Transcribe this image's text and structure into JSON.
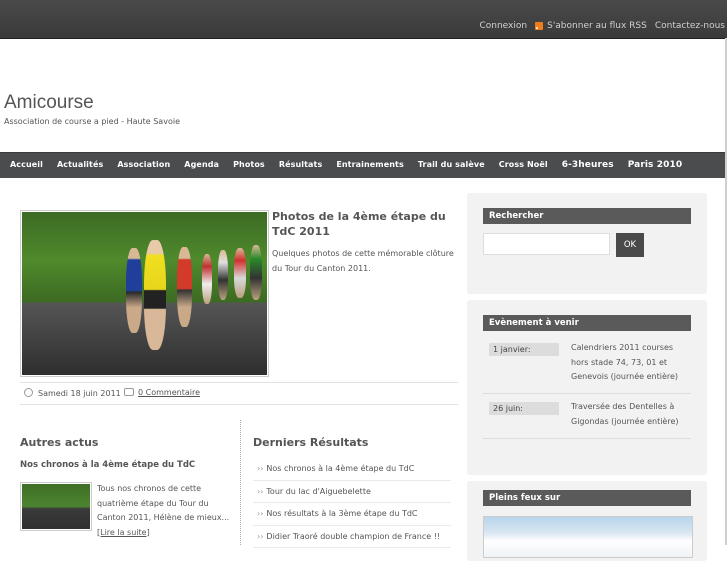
{
  "topbar": {
    "links": [
      "Connexion",
      "S'abonner au flux RSS",
      "Contactez-nous"
    ]
  },
  "site": {
    "title": "Amicourse",
    "description": "Association de course a pied - Haute Savoie"
  },
  "nav": {
    "items": [
      "Accueil",
      "Actualités",
      "Association",
      "Agenda",
      "Photos",
      "Résultats",
      "Entrainements",
      "Trail du salève",
      "Cross Noël",
      "6-3heures",
      "Paris 2010"
    ]
  },
  "featured": {
    "title": "Photos de la 4ème étape du TdC 2011",
    "excerpt": "Quelques photos de cette mémorable clôture du Tour du Canton 2011.",
    "date": "Samedi 18 juin 2011",
    "comments": "0 Commentaire"
  },
  "autres": {
    "heading": "Autres actus",
    "post_title": "Nos chronos à la 4ème étape du TdC",
    "excerpt": "Tous nos chronos de cette quatrième étape du Tour du Canton 2011, Hélène de mieux...",
    "more": "[Lire la suite]"
  },
  "derniers": {
    "heading": "Derniers Résultats",
    "items": [
      "Nos chronos à la 4ème étape du TdC",
      "Tour du lac d'Aiguebelette",
      "Nos résultats à la 3ème étape du TdC",
      "Didier Traoré double champion de France !!"
    ]
  },
  "sidebar": {
    "search": {
      "title": "Rechercher",
      "button": "OK",
      "value": ""
    },
    "events": {
      "title": "Evènement à venir",
      "items": [
        {
          "date": "1 janvier:",
          "text": "Calendriers 2011 courses hors stade 74, 73, 01 et Genevois (journée entière)"
        },
        {
          "date": "26 juin:",
          "text": "Traversée des Dentelles à Gigondas (journée entière)"
        }
      ]
    },
    "pleins_feux": {
      "title": "Pleins feux sur"
    }
  },
  "colors": {
    "nav_bg": "#4a4c4e",
    "widget_title_bg": "#5a5a5a",
    "rss": "#f07d1a"
  }
}
